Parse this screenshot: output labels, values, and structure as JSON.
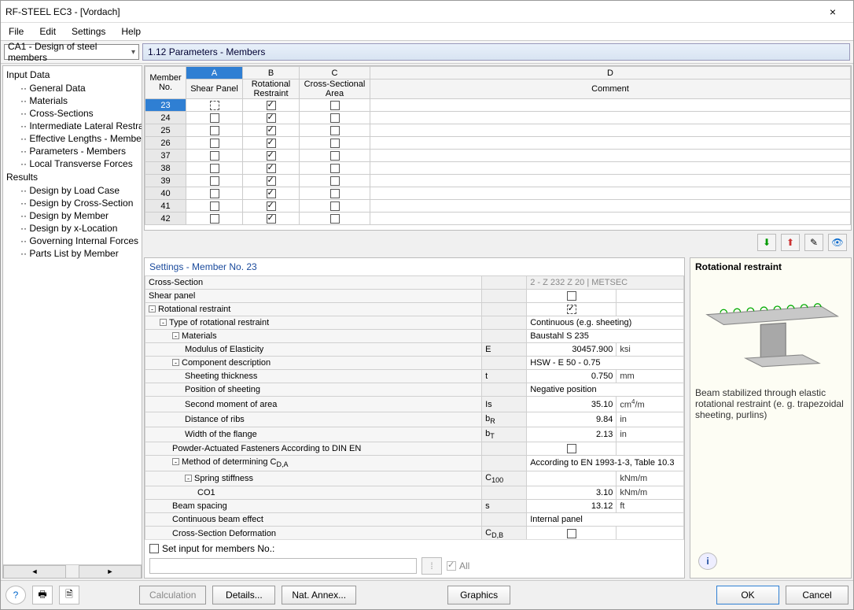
{
  "title": "RF-STEEL EC3 - [Vordach]",
  "menu": [
    "File",
    "Edit",
    "Settings",
    "Help"
  ],
  "combo_label": "CA1 - Design of steel members",
  "panel_title": "1.12 Parameters - Members",
  "tree": {
    "input": "Input Data",
    "input_items": [
      "General Data",
      "Materials",
      "Cross-Sections",
      "Intermediate Lateral Restraints",
      "Effective Lengths - Members",
      "Parameters - Members",
      "Local Transverse Forces"
    ],
    "results": "Results",
    "results_items": [
      "Design by Load Case",
      "Design by Cross-Section",
      "Design by Member",
      "Design by x-Location",
      "Governing Internal Forces by M",
      "Parts List by Member"
    ]
  },
  "grid": {
    "colhdr": {
      "m": "Member No.",
      "a": "A",
      "b": "B",
      "c": "C",
      "d": "D",
      "a2": "Shear Panel",
      "b2": "Rotational Restraint",
      "c2": "Cross-Sectional Area",
      "d2": "Comment"
    },
    "rows": [
      {
        "no": "23",
        "a": false,
        "a_dashed": true,
        "b": true,
        "c": false
      },
      {
        "no": "24",
        "a": false,
        "b": true,
        "c": false
      },
      {
        "no": "25",
        "a": false,
        "b": true,
        "c": false
      },
      {
        "no": "26",
        "a": false,
        "b": true,
        "c": false
      },
      {
        "no": "37",
        "a": false,
        "b": true,
        "c": false
      },
      {
        "no": "38",
        "a": false,
        "b": true,
        "c": false
      },
      {
        "no": "39",
        "a": false,
        "b": true,
        "c": false
      },
      {
        "no": "40",
        "a": false,
        "b": true,
        "c": false
      },
      {
        "no": "41",
        "a": false,
        "b": true,
        "c": false
      },
      {
        "no": "42",
        "a": false,
        "b": true,
        "c": false
      }
    ]
  },
  "settings": {
    "title": "Settings - Member No. 23",
    "rows": [
      {
        "ind": 0,
        "label": "Cross-Section",
        "sym": "",
        "val": "",
        "span": "2 - Z 232 Z 20 | METSEC",
        "gray": true
      },
      {
        "ind": 0,
        "label": "Shear panel",
        "sym": "",
        "val": "",
        "chk": false
      },
      {
        "ind": 0,
        "exp": "-",
        "label": "Rotational restraint",
        "sym": "",
        "val": "",
        "chk": true,
        "chk_dashed": true
      },
      {
        "ind": 1,
        "exp": "-",
        "label": "Type of rotational restraint",
        "span": "Continuous (e.g. sheeting)"
      },
      {
        "ind": 2,
        "exp": "-",
        "label": "Materials",
        "span": "Baustahl S 235"
      },
      {
        "ind": 3,
        "label": "Modulus of Elasticity",
        "sym": "E",
        "val": "30457.900",
        "unit": "ksi"
      },
      {
        "ind": 2,
        "exp": "-",
        "label": "Component description",
        "span": "HSW - E 50 - 0.75"
      },
      {
        "ind": 3,
        "label": "Sheeting thickness",
        "sym": "t",
        "val": "0.750",
        "unit": "mm"
      },
      {
        "ind": 3,
        "label": "Position of sheeting",
        "span": "Negative position"
      },
      {
        "ind": 3,
        "label": "Second moment of area",
        "sym": "Is",
        "val": "35.10",
        "unit_html": "cm<sup style='font-size:8px'>4</sup>/m"
      },
      {
        "ind": 3,
        "label": "Distance of ribs",
        "sym_html": "b<sub>R</sub>",
        "val": "9.84",
        "unit": "in"
      },
      {
        "ind": 3,
        "label": "Width of the flange",
        "sym_html": "b<sub>T</sub>",
        "val": "2.13",
        "unit": "in"
      },
      {
        "ind": 2,
        "label": "Powder-Actuated Fasteners According to DIN EN",
        "chk": false
      },
      {
        "ind": 2,
        "exp": "-",
        "label": "Method of determining C<sub>D,A</sub>",
        "span": "According to EN 1993-1-3, Table 10.3",
        "label_html": true
      },
      {
        "ind": 3,
        "exp": "-",
        "label": "Spring stiffness",
        "sym_html": "C<sub>100</sub>",
        "val": "",
        "unit": "kNm/m"
      },
      {
        "ind": 3,
        "label": "CO1",
        "sym": "",
        "val": "3.10",
        "unit": "kNm/m",
        "extra_indent": true
      },
      {
        "ind": 2,
        "label": "Beam spacing",
        "sym": "s",
        "val": "13.12",
        "unit": "ft"
      },
      {
        "ind": 2,
        "label": "Continuous beam effect",
        "span": "Internal panel"
      },
      {
        "ind": 2,
        "label": "Cross-Section Deformation",
        "sym_html": "C<sub>D,B</sub>",
        "chk": false
      }
    ],
    "set_label": "Set input for members No.:",
    "all": "All"
  },
  "info": {
    "title": "Rotational restraint",
    "text": "Beam stabilized through elastic rotational restraint (e. g. trapezoidal sheeting, purlins)"
  },
  "footer": {
    "calc": "Calculation",
    "details": "Details...",
    "nat": "Nat. Annex...",
    "graphics": "Graphics",
    "ok": "OK",
    "cancel": "Cancel"
  }
}
